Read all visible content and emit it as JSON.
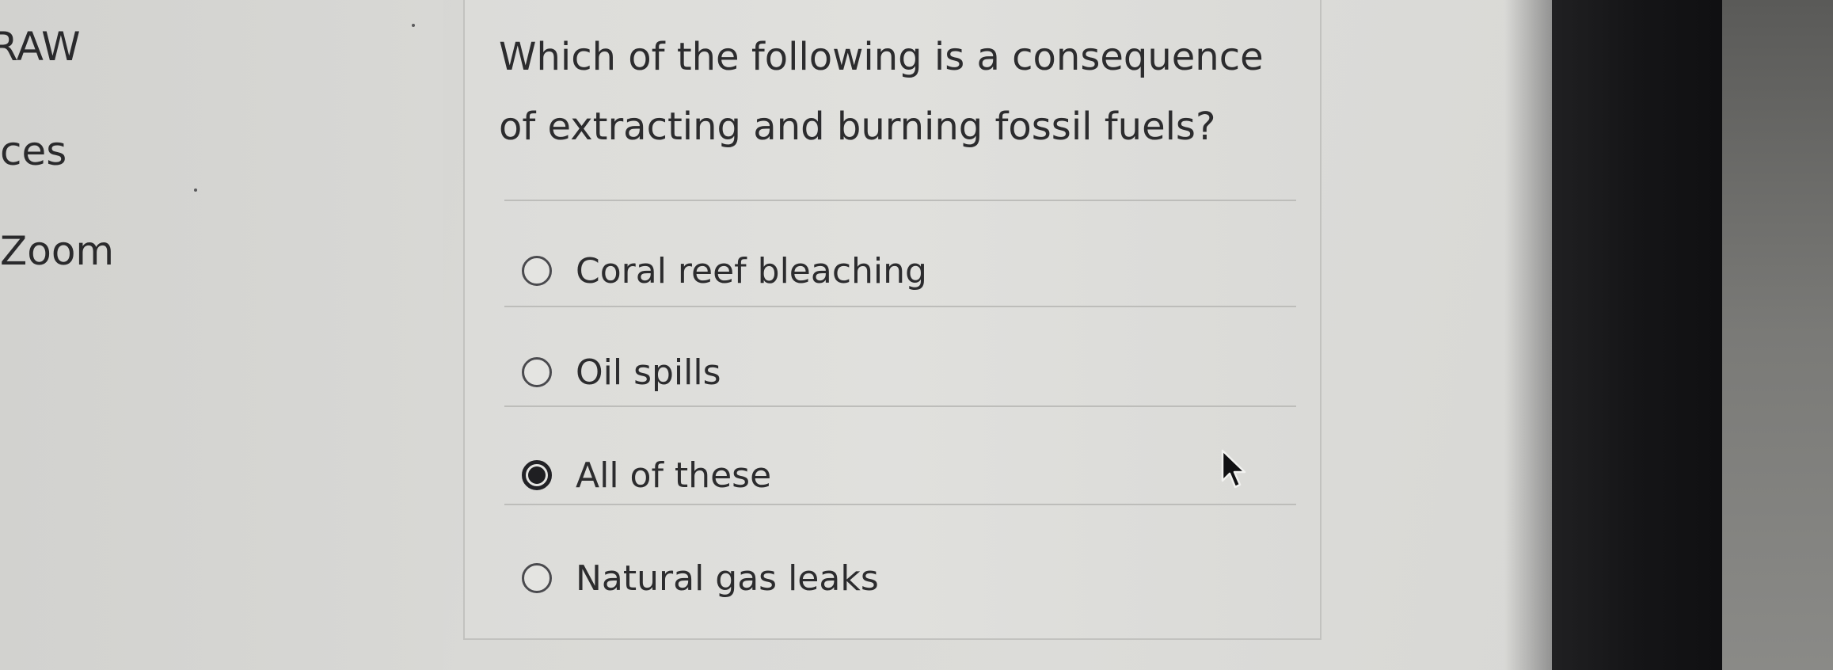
{
  "sidebar": {
    "items": [
      {
        "label": "RAW"
      },
      {
        "label": "ces"
      },
      {
        "label": "Zoom"
      }
    ]
  },
  "question": {
    "text": "Which of the following is a consequence of extracting and burning fossil fuels?",
    "options": [
      {
        "label": "Coral reef bleaching",
        "selected": false
      },
      {
        "label": "Oil spills",
        "selected": false
      },
      {
        "label": "All of these",
        "selected": true
      },
      {
        "label": "Natural gas leaks",
        "selected": false
      }
    ]
  },
  "icons": {
    "cursor": "mouse-pointer-icon",
    "radio_unchecked": "radio-unchecked-icon",
    "radio_checked": "radio-checked-icon"
  },
  "colors": {
    "text": "#2c2c2e",
    "selected_radio": "#1f1f22",
    "panel_background": "#dedeDb"
  }
}
